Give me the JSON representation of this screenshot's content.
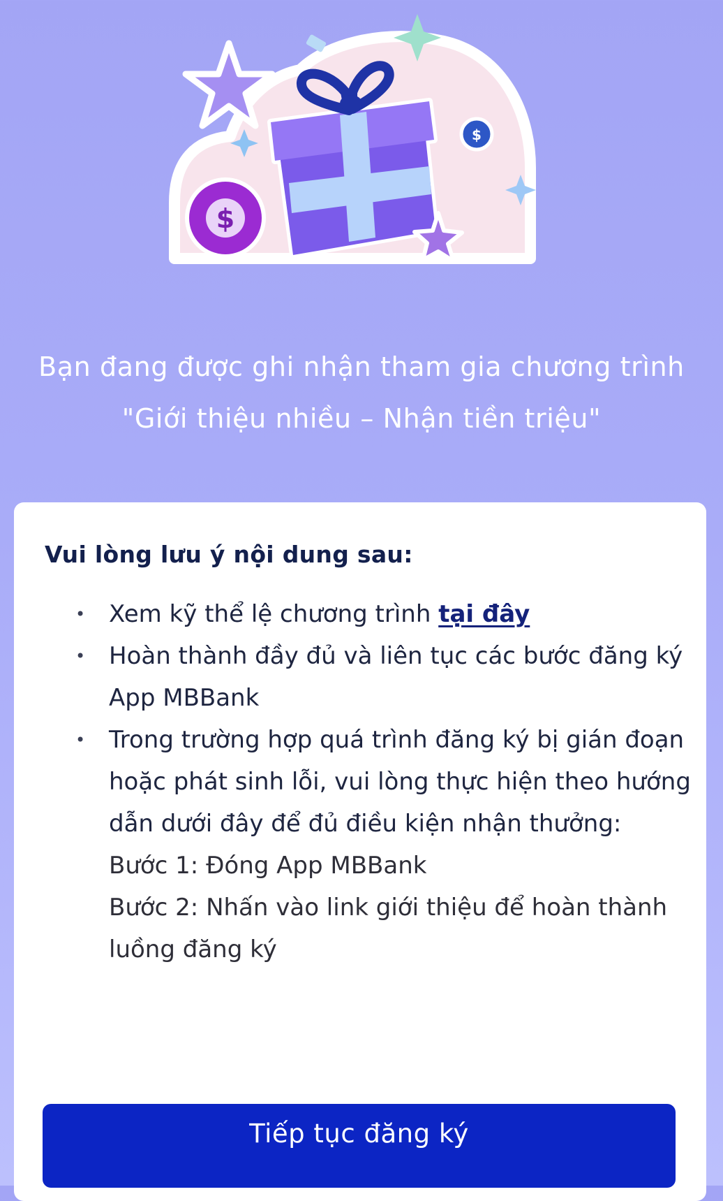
{
  "hero": {
    "illustration_icon": "gift-box-with-coins-and-stars",
    "coin_symbol": "$"
  },
  "headline": "Bạn đang được ghi nhận tham gia chương trình \"Giới thiệu nhiều – Nhận tiền triệu\"",
  "notice": {
    "title": "Vui lòng lưu ý nội dung sau:",
    "items": [
      {
        "text": "Xem kỹ thể lệ chương trình ",
        "link": "tại đây"
      },
      {
        "text": "Hoàn thành đầy đủ và liên tục các bước đăng ký App MBBank"
      },
      {
        "text": "Trong trường hợp quá trình đăng ký bị gián đoạn hoặc phát sinh lỗi, vui lòng thực hiện theo hướng dẫn dưới đây để đủ điều kiện nhận thưởng:",
        "steps": [
          "Bước 1: Đóng App MBBank",
          "Bước 2: Nhấn vào link giới thiệu để hoàn thành luồng đăng ký"
        ]
      }
    ]
  },
  "cta": {
    "label": "Tiếp tục đăng ký"
  },
  "colors": {
    "background": "#a8abf7",
    "card": "#ffffff",
    "primary_button": "#0c25c4",
    "gift_box": "#7b5bea",
    "ribbon": "#b7d3fb",
    "bow": "#1f33a6",
    "coin_large": "#9b2bd2",
    "link": "#14227a"
  }
}
